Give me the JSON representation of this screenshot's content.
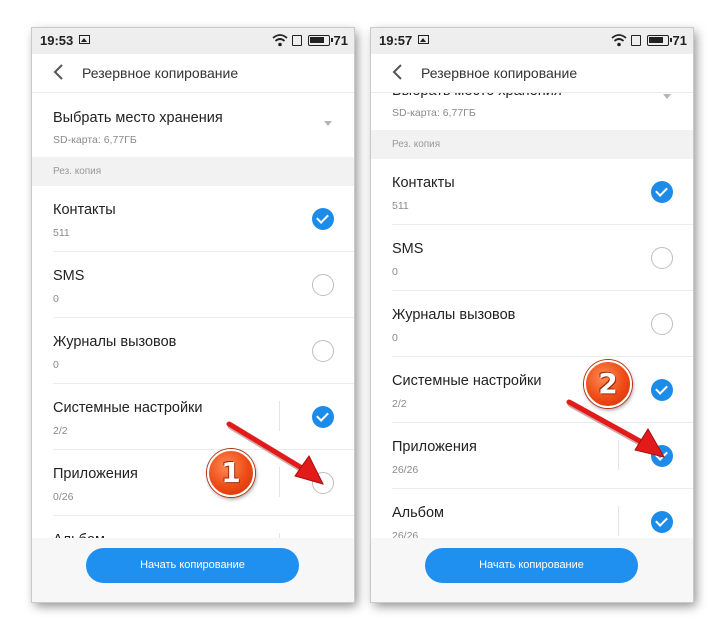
{
  "colors": {
    "accent": "#1d8be8",
    "annotation_arrow": "#e21a1a",
    "badge": "#ee4a14"
  },
  "left_screen": {
    "status_bar": {
      "time": "19:53",
      "battery": "71",
      "icons": [
        "image-icon",
        "wifi-icon",
        "sim-icon",
        "battery-icon"
      ]
    },
    "title": "Резервное копирование",
    "storage": {
      "title": "Выбрать место хранения",
      "value": "SD-карта: 6,77ГБ"
    },
    "section_header": "Рез. копия",
    "items": [
      {
        "name": "Контакты",
        "count": "511",
        "checked": true
      },
      {
        "name": "SMS",
        "count": "0",
        "checked": false
      },
      {
        "name": "Журналы вызовов",
        "count": "0",
        "checked": false
      },
      {
        "name": "Системные настройки",
        "count": "2/2",
        "checked": true
      },
      {
        "name": "Приложения",
        "count": "0/26",
        "checked": false
      },
      {
        "name": "Альбом",
        "count": "",
        "checked": true
      }
    ],
    "start_button": "Начать копирование",
    "annotation_step": "1"
  },
  "right_screen": {
    "status_bar": {
      "time": "19:57",
      "battery": "71",
      "icons": [
        "image-icon",
        "wifi-icon",
        "sim-icon",
        "battery-icon"
      ]
    },
    "title": "Резервное копирование",
    "storage": {
      "title": "Выбрать место хранения",
      "value": "SD-карта: 6,77ГБ"
    },
    "section_header": "Рез. копия",
    "items": [
      {
        "name": "Контакты",
        "count": "511",
        "checked": true
      },
      {
        "name": "SMS",
        "count": "0",
        "checked": false
      },
      {
        "name": "Журналы вызовов",
        "count": "0",
        "checked": false
      },
      {
        "name": "Системные настройки",
        "count": "2/2",
        "checked": true
      },
      {
        "name": "Приложения",
        "count": "26/26",
        "checked": true
      },
      {
        "name": "Альбом",
        "count": "26/26",
        "checked": true
      }
    ],
    "start_button": "Начать копирование",
    "annotation_step": "2"
  }
}
